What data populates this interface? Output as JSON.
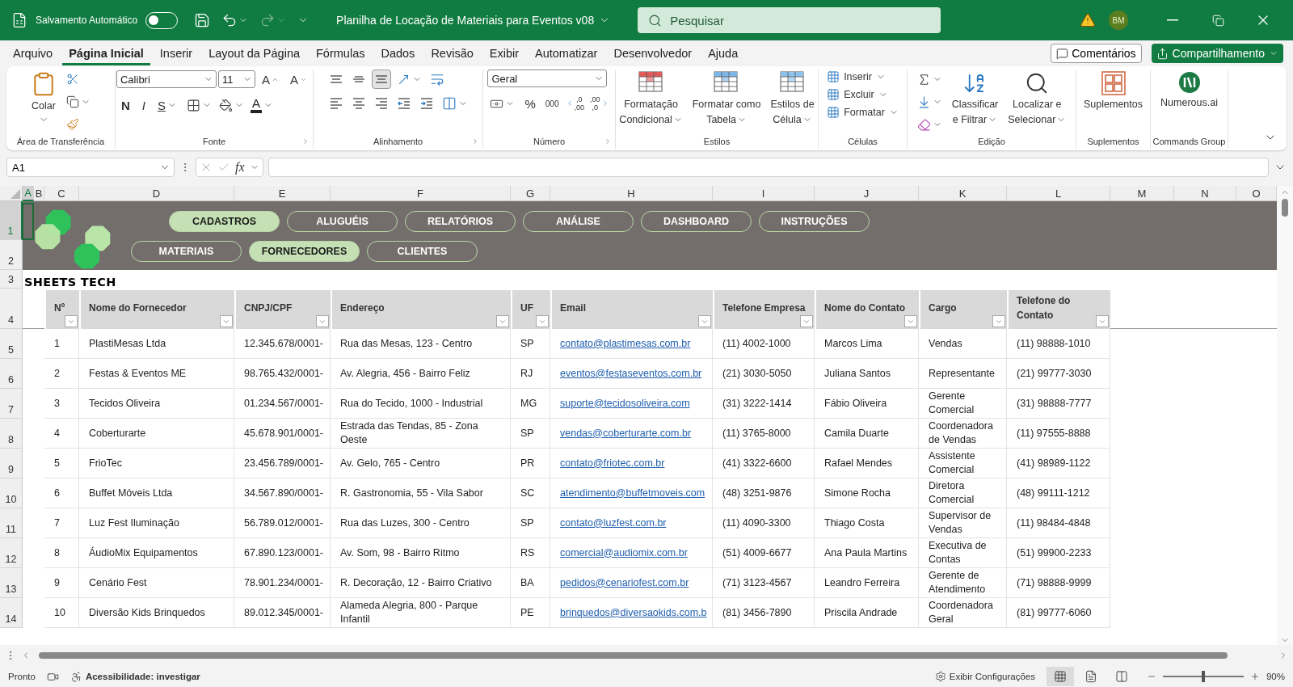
{
  "window": {
    "title": "Planilha de Locação de Materiais para Eventos v08",
    "autosave": {
      "label": "Salvamento Automático",
      "on": false
    },
    "search_placeholder": "Pesquisar",
    "user_initials": "BM"
  },
  "menu_tabs": [
    {
      "label": "Arquivo",
      "selected": false
    },
    {
      "label": "Página Inicial",
      "selected": true
    },
    {
      "label": "Inserir",
      "selected": false
    },
    {
      "label": "Layout da Página",
      "selected": false
    },
    {
      "label": "Fórmulas",
      "selected": false
    },
    {
      "label": "Dados",
      "selected": false
    },
    {
      "label": "Revisão",
      "selected": false
    },
    {
      "label": "Exibir",
      "selected": false
    },
    {
      "label": "Automatizar",
      "selected": false
    },
    {
      "label": "Desenvolvedor",
      "selected": false
    },
    {
      "label": "Ajuda",
      "selected": false
    }
  ],
  "header_buttons": {
    "comments": "Comentários",
    "share": "Compartilhamento"
  },
  "ribbon": {
    "clipboard": {
      "label": "Área de Transferência",
      "paste": "Colar"
    },
    "font": {
      "label": "Fonte",
      "name": "Calibri",
      "size": "11",
      "grow": "A",
      "shrink": "A",
      "bold": "N",
      "italic": "I",
      "underline": "S",
      "color_letter": "A"
    },
    "alignment": {
      "label": "Alinhamento",
      "bottom_align_selected": true
    },
    "number": {
      "label": "Número",
      "format": "Geral",
      "percent": "%",
      "thousands": "000",
      "increase_decimal": {
        "top": ",0",
        "bottom": ",00"
      },
      "decrease_decimal": {
        "top": ",00",
        "bottom": ",0"
      }
    },
    "styles": {
      "label": "Estilos",
      "buttons": [
        {
          "line1": "Formatação",
          "line2": "Condicional"
        },
        {
          "line1": "Formatar como",
          "line2": "Tabela"
        },
        {
          "line1": "Estilos de",
          "line2": "Célula"
        }
      ]
    },
    "cells": {
      "label": "Células",
      "buttons": [
        "Inserir",
        "Excluir",
        "Formatar"
      ]
    },
    "editing": {
      "label": "Edição",
      "buttons": [
        {
          "line1": "Classificar",
          "line2": "e Filtrar"
        },
        {
          "line1": "Localizar e",
          "line2": "Selecionar"
        }
      ]
    },
    "addins": {
      "label": "Suplementos",
      "button": "Suplementos"
    },
    "commands": {
      "label": "Commands Group",
      "button": "Numerous.ai"
    }
  },
  "formula_bar": {
    "name_box": "A1",
    "fx": "fx"
  },
  "columns": [
    {
      "label": "A",
      "selected": true
    },
    {
      "label": "B",
      "selected": false
    },
    {
      "label": "C",
      "selected": false
    },
    {
      "label": "D",
      "selected": false
    },
    {
      "label": "E",
      "selected": false
    },
    {
      "label": "F",
      "selected": false
    },
    {
      "label": "G",
      "selected": false
    },
    {
      "label": "H",
      "selected": false
    },
    {
      "label": "I",
      "selected": false
    },
    {
      "label": "J",
      "selected": false
    },
    {
      "label": "K",
      "selected": false
    },
    {
      "label": "L",
      "selected": false
    },
    {
      "label": "M",
      "selected": false
    },
    {
      "label": "N",
      "selected": false
    },
    {
      "label": "O",
      "selected": false
    }
  ],
  "rows": [
    {
      "label": "1",
      "selected": true
    },
    {
      "label": "2",
      "selected": false
    },
    {
      "label": "3",
      "selected": false
    },
    {
      "label": "4",
      "selected": false
    },
    {
      "label": "5",
      "selected": false
    },
    {
      "label": "6",
      "selected": false
    },
    {
      "label": "7",
      "selected": false
    },
    {
      "label": "8",
      "selected": false
    },
    {
      "label": "9",
      "selected": false
    },
    {
      "label": "10",
      "selected": false
    },
    {
      "label": "11",
      "selected": false
    },
    {
      "label": "12",
      "selected": false
    },
    {
      "label": "13",
      "selected": false
    },
    {
      "label": "14",
      "selected": false
    }
  ],
  "banner": {
    "brand": "SHEETS TECH",
    "nav_top": [
      {
        "label": "CADASTROS",
        "selected": true
      },
      {
        "label": "ALUGUÉIS",
        "selected": false
      },
      {
        "label": "RELATÓRIOS",
        "selected": false
      },
      {
        "label": "ANÁLISE",
        "selected": false
      },
      {
        "label": "DASHBOARD",
        "selected": false
      },
      {
        "label": "INSTRUÇÕES",
        "selected": false
      }
    ],
    "nav_bottom": [
      {
        "label": "MATERIAIS",
        "selected": false
      },
      {
        "label": "FORNECEDORES",
        "selected": true
      },
      {
        "label": "CLIENTES",
        "selected": false
      }
    ]
  },
  "table": {
    "columns": [
      {
        "label": "Nº",
        "kind": "text"
      },
      {
        "label": "Nome do Fornecedor",
        "kind": "text"
      },
      {
        "label": "CNPJ/CPF",
        "kind": "text"
      },
      {
        "label": "Endereço",
        "kind": "text"
      },
      {
        "label": "UF",
        "kind": "text"
      },
      {
        "label": "Email",
        "kind": "link"
      },
      {
        "label": "Telefone Empresa",
        "kind": "text"
      },
      {
        "label": "Nome do Contato",
        "kind": "text"
      },
      {
        "label": "Cargo",
        "kind": "text"
      },
      {
        "label": "Telefone do Contato",
        "kind": "text"
      }
    ],
    "rows": [
      [
        "1",
        "PlastiMesas Ltda",
        "12.345.678/0001-",
        "Rua das Mesas, 123 - Centro",
        "SP",
        "contato@plastimesas.com.br",
        "(11) 4002-1000",
        "Marcos Lima",
        "Vendas",
        "(11) 98888-1010"
      ],
      [
        "2",
        "Festas & Eventos ME",
        "98.765.432/0001-",
        "Av. Alegria, 456 - Bairro Feliz",
        "RJ",
        "eventos@festaseventos.com.br",
        "(21) 3030-5050",
        "Juliana Santos",
        "Representante",
        "(21) 99777-3030"
      ],
      [
        "3",
        "Tecidos Oliveira",
        "01.234.567/0001-",
        "Rua do Tecido, 1000 - Industrial",
        "MG",
        "suporte@tecidosoliveira.com",
        "(31) 3222-1414",
        "Fábio Oliveira",
        "Gerente Comercial",
        "(31) 98888-7777"
      ],
      [
        "4",
        "Coberturarte",
        "45.678.901/0001-",
        "Estrada das Tendas, 85 - Zona Oeste",
        "SP",
        "vendas@coberturarte.com.br",
        "(11) 3765-8000",
        "Camila Duarte",
        "Coordenadora de Vendas",
        "(11) 97555-8888"
      ],
      [
        "5",
        "FrioTec",
        "23.456.789/0001-",
        "Av. Gelo, 765 - Centro",
        "PR",
        "contato@friotec.com.br",
        "(41) 3322-6600",
        "Rafael Mendes",
        "Assistente Comercial",
        "(41) 98989-1122"
      ],
      [
        "6",
        "Buffet Móveis Ltda",
        "34.567.890/0001-",
        "R. Gastronomia, 55 - Vila Sabor",
        "SC",
        "atendimento@buffetmoveis.com",
        "(48) 3251-9876",
        "Simone Rocha",
        "Diretora Comercial",
        "(48) 99111-1212"
      ],
      [
        "7",
        "Luz Fest Iluminação",
        "56.789.012/0001-",
        "Rua das Luzes, 300 - Centro",
        "SP",
        "contato@luzfest.com.br",
        "(11) 4090-3300",
        "Thiago Costa",
        "Supervisor de Vendas",
        "(11) 98484-4848"
      ],
      [
        "8",
        "ÁudioMix Equipamentos",
        "67.890.123/0001-",
        "Av. Som, 98 - Bairro Ritmo",
        "RS",
        "comercial@audiomix.com.br",
        "(51) 4009-6677",
        "Ana Paula Martins",
        "Executiva de Contas",
        "(51) 99900-2233"
      ],
      [
        "9",
        "Cenário Fest",
        "78.901.234/0001-",
        "R. Decoração, 12 - Bairro Criativo",
        "BA",
        "pedidos@cenariofest.com.br",
        "(71) 3123-4567",
        "Leandro Ferreira",
        "Gerente de Atendimento",
        "(71) 98888-9999"
      ],
      [
        "10",
        "Diversão Kids Brinquedos",
        "89.012.345/0001-",
        "Alameda Alegria, 800 - Parque Infantil",
        "PE",
        "brinquedos@diversaokids.com.b",
        "(81) 3456-7890",
        "Priscila Andrade",
        "Coordenadora Geral",
        "(81) 99777-6060"
      ]
    ]
  },
  "status_bar": {
    "ready": "Pronto",
    "accessibility": "Acessibilidade: investigar",
    "view_settings": "Exibir Configurações",
    "views": [
      {
        "kind": "normal",
        "selected": true
      },
      {
        "kind": "page_layout",
        "selected": false
      },
      {
        "kind": "page_break",
        "selected": false
      }
    ],
    "zoom": {
      "level": 0.5,
      "reading": "90%"
    }
  }
}
